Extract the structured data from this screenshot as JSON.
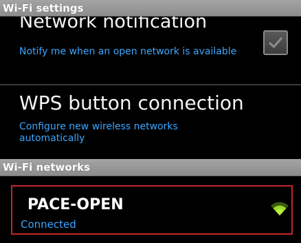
{
  "headers": {
    "wifi_settings": "Wi-Fi settings",
    "wifi_networks": "Wi-Fi networks"
  },
  "network_notification": {
    "title": "Network notification",
    "summary": "Notify me when an open network is available",
    "checked": true
  },
  "wps": {
    "title": "WPS button connection",
    "summary": "Configure new wireless networks automatically"
  },
  "networks": [
    {
      "ssid": "PACE-OPEN",
      "status": "Connected",
      "icon": "wifi-signal-icon"
    }
  ],
  "colors": {
    "header_bg": "#9a9a9a",
    "summary_text": "#3da6ff",
    "highlight_border": "#c0282a",
    "wifi_icon": "#9ad82a"
  }
}
